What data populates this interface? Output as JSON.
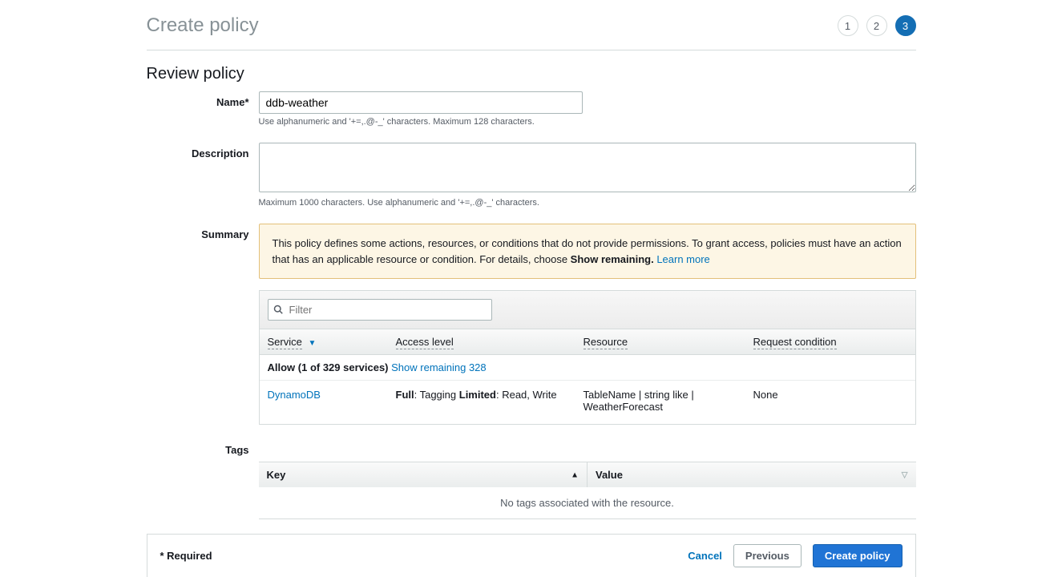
{
  "page": {
    "title": "Create policy",
    "section_title": "Review policy"
  },
  "steps": {
    "s1": "1",
    "s2": "2",
    "s3": "3"
  },
  "name": {
    "label": "Name*",
    "value": "ddb-weather",
    "hint": "Use alphanumeric and '+=,.@-_' characters. Maximum 128 characters."
  },
  "description": {
    "label": "Description",
    "value": "",
    "hint": "Maximum 1000 characters. Use alphanumeric and '+=,.@-_' characters."
  },
  "summary": {
    "label": "Summary",
    "text_before": "This policy defines some actions, resources, or conditions that do not provide permissions. To grant access, policies must have an action that has an applicable resource or condition. For details, choose ",
    "show_remaining_bold": "Show remaining.",
    "learn_more": "Learn more"
  },
  "filter": {
    "placeholder": "Filter"
  },
  "headers": {
    "service": "Service",
    "access": "Access level",
    "resource": "Resource",
    "condition": "Request condition"
  },
  "allow": {
    "text": "Allow (1 of 329 services) ",
    "link": "Show remaining 328"
  },
  "row": {
    "service": "DynamoDB",
    "access_full_label": "Full",
    "access_full_val": ": Tagging ",
    "access_limited_label": "Limited",
    "access_limited_val": ": Read, Write",
    "resource": "TableName | string like | WeatherForecast",
    "condition": "None"
  },
  "tags": {
    "label": "Tags",
    "key": "Key",
    "value": "Value",
    "empty": "No tags associated with the resource."
  },
  "footer": {
    "required": "* Required",
    "cancel": "Cancel",
    "previous": "Previous",
    "create": "Create policy"
  }
}
